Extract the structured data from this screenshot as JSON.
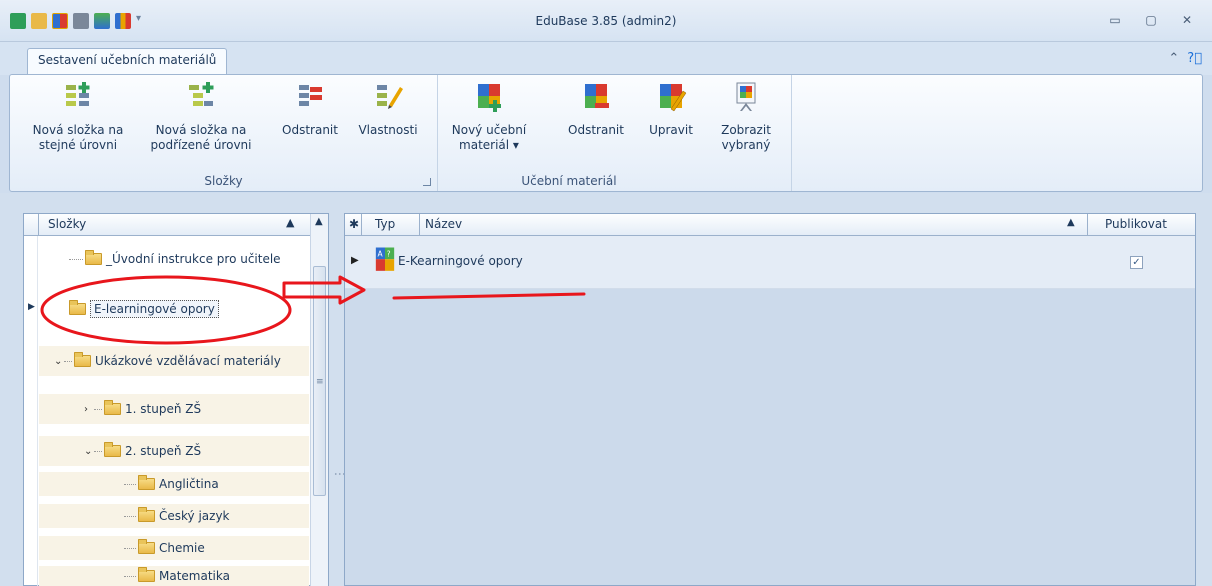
{
  "window": {
    "title": "EduBase 3.85 (admin2)",
    "controls": [
      "▭",
      "▢",
      "✕"
    ]
  },
  "ribbon": {
    "tab": "Sestavení učebních materiálů",
    "groups": {
      "folders": {
        "label": "Složky",
        "buttons": [
          {
            "line1": "Nová složka na",
            "line2": "stejné úrovni"
          },
          {
            "line1": "Nová složka na",
            "line2": "podřízené úrovni"
          },
          {
            "line1": "Odstranit",
            "line2": ""
          },
          {
            "line1": "Vlastnosti",
            "line2": ""
          }
        ]
      },
      "material": {
        "label": "Učební materiál",
        "buttons": [
          {
            "line1": "Nový učební",
            "line2": "materiál ▾"
          },
          {
            "line1": "Odstranit",
            "line2": ""
          },
          {
            "line1": "Upravit",
            "line2": ""
          },
          {
            "line1": "Zobrazit",
            "line2": "vybraný"
          }
        ]
      }
    }
  },
  "tree": {
    "header": "Složky",
    "items": [
      {
        "label": "_Úvodní instrukce pro učitele"
      },
      {
        "label": "E-learningové opory"
      },
      {
        "label": "Ukázkové vzdělávací materiály"
      },
      {
        "label": "1. stupeň ZŠ"
      },
      {
        "label": "2. stupeň ZŠ"
      },
      {
        "label": "Angličtina"
      },
      {
        "label": "Český jazyk"
      },
      {
        "label": "Chemie"
      },
      {
        "label": "Matematika"
      }
    ]
  },
  "grid": {
    "columns": {
      "type": "Typ",
      "name": "Název",
      "publish": "Publikovat"
    },
    "rows": [
      {
        "name": "E-Kearningové opory",
        "published": "✓"
      }
    ]
  },
  "colors": {
    "annotation": "#e8161c",
    "accent": "#1e395b"
  }
}
